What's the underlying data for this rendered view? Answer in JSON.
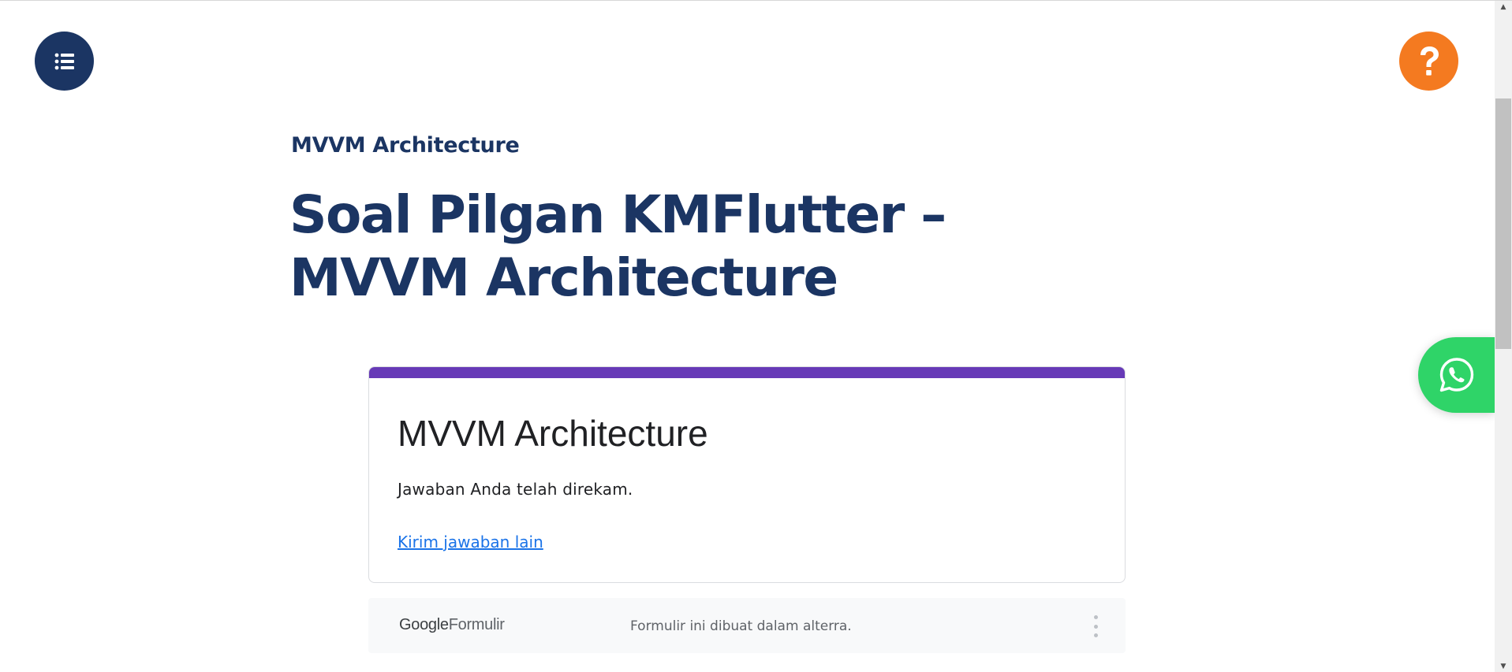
{
  "header": {
    "toc_icon": "list-icon",
    "help_icon": "question-mark-icon",
    "help_label": "?"
  },
  "article": {
    "category": "MVVM Architecture",
    "title": "Soal Pilgan KMFlutter – MVVM Architecture"
  },
  "form": {
    "accent_color": "#673ab7",
    "title": "MVVM Architecture",
    "message": "Jawaban Anda telah direkam.",
    "link": "Kirim jawaban lain",
    "footer": {
      "logo_google": "Google",
      "logo_product": "Formulir",
      "note": "Formulir ini dibuat dalam alterra.",
      "menu_icon": "more-vertical-icon"
    }
  },
  "floating": {
    "whatsapp_icon": "whatsapp-icon",
    "whatsapp_color": "#2fd468"
  },
  "colors": {
    "primary": "#1b3563",
    "help": "#f47a20",
    "link": "#1a73e8"
  }
}
